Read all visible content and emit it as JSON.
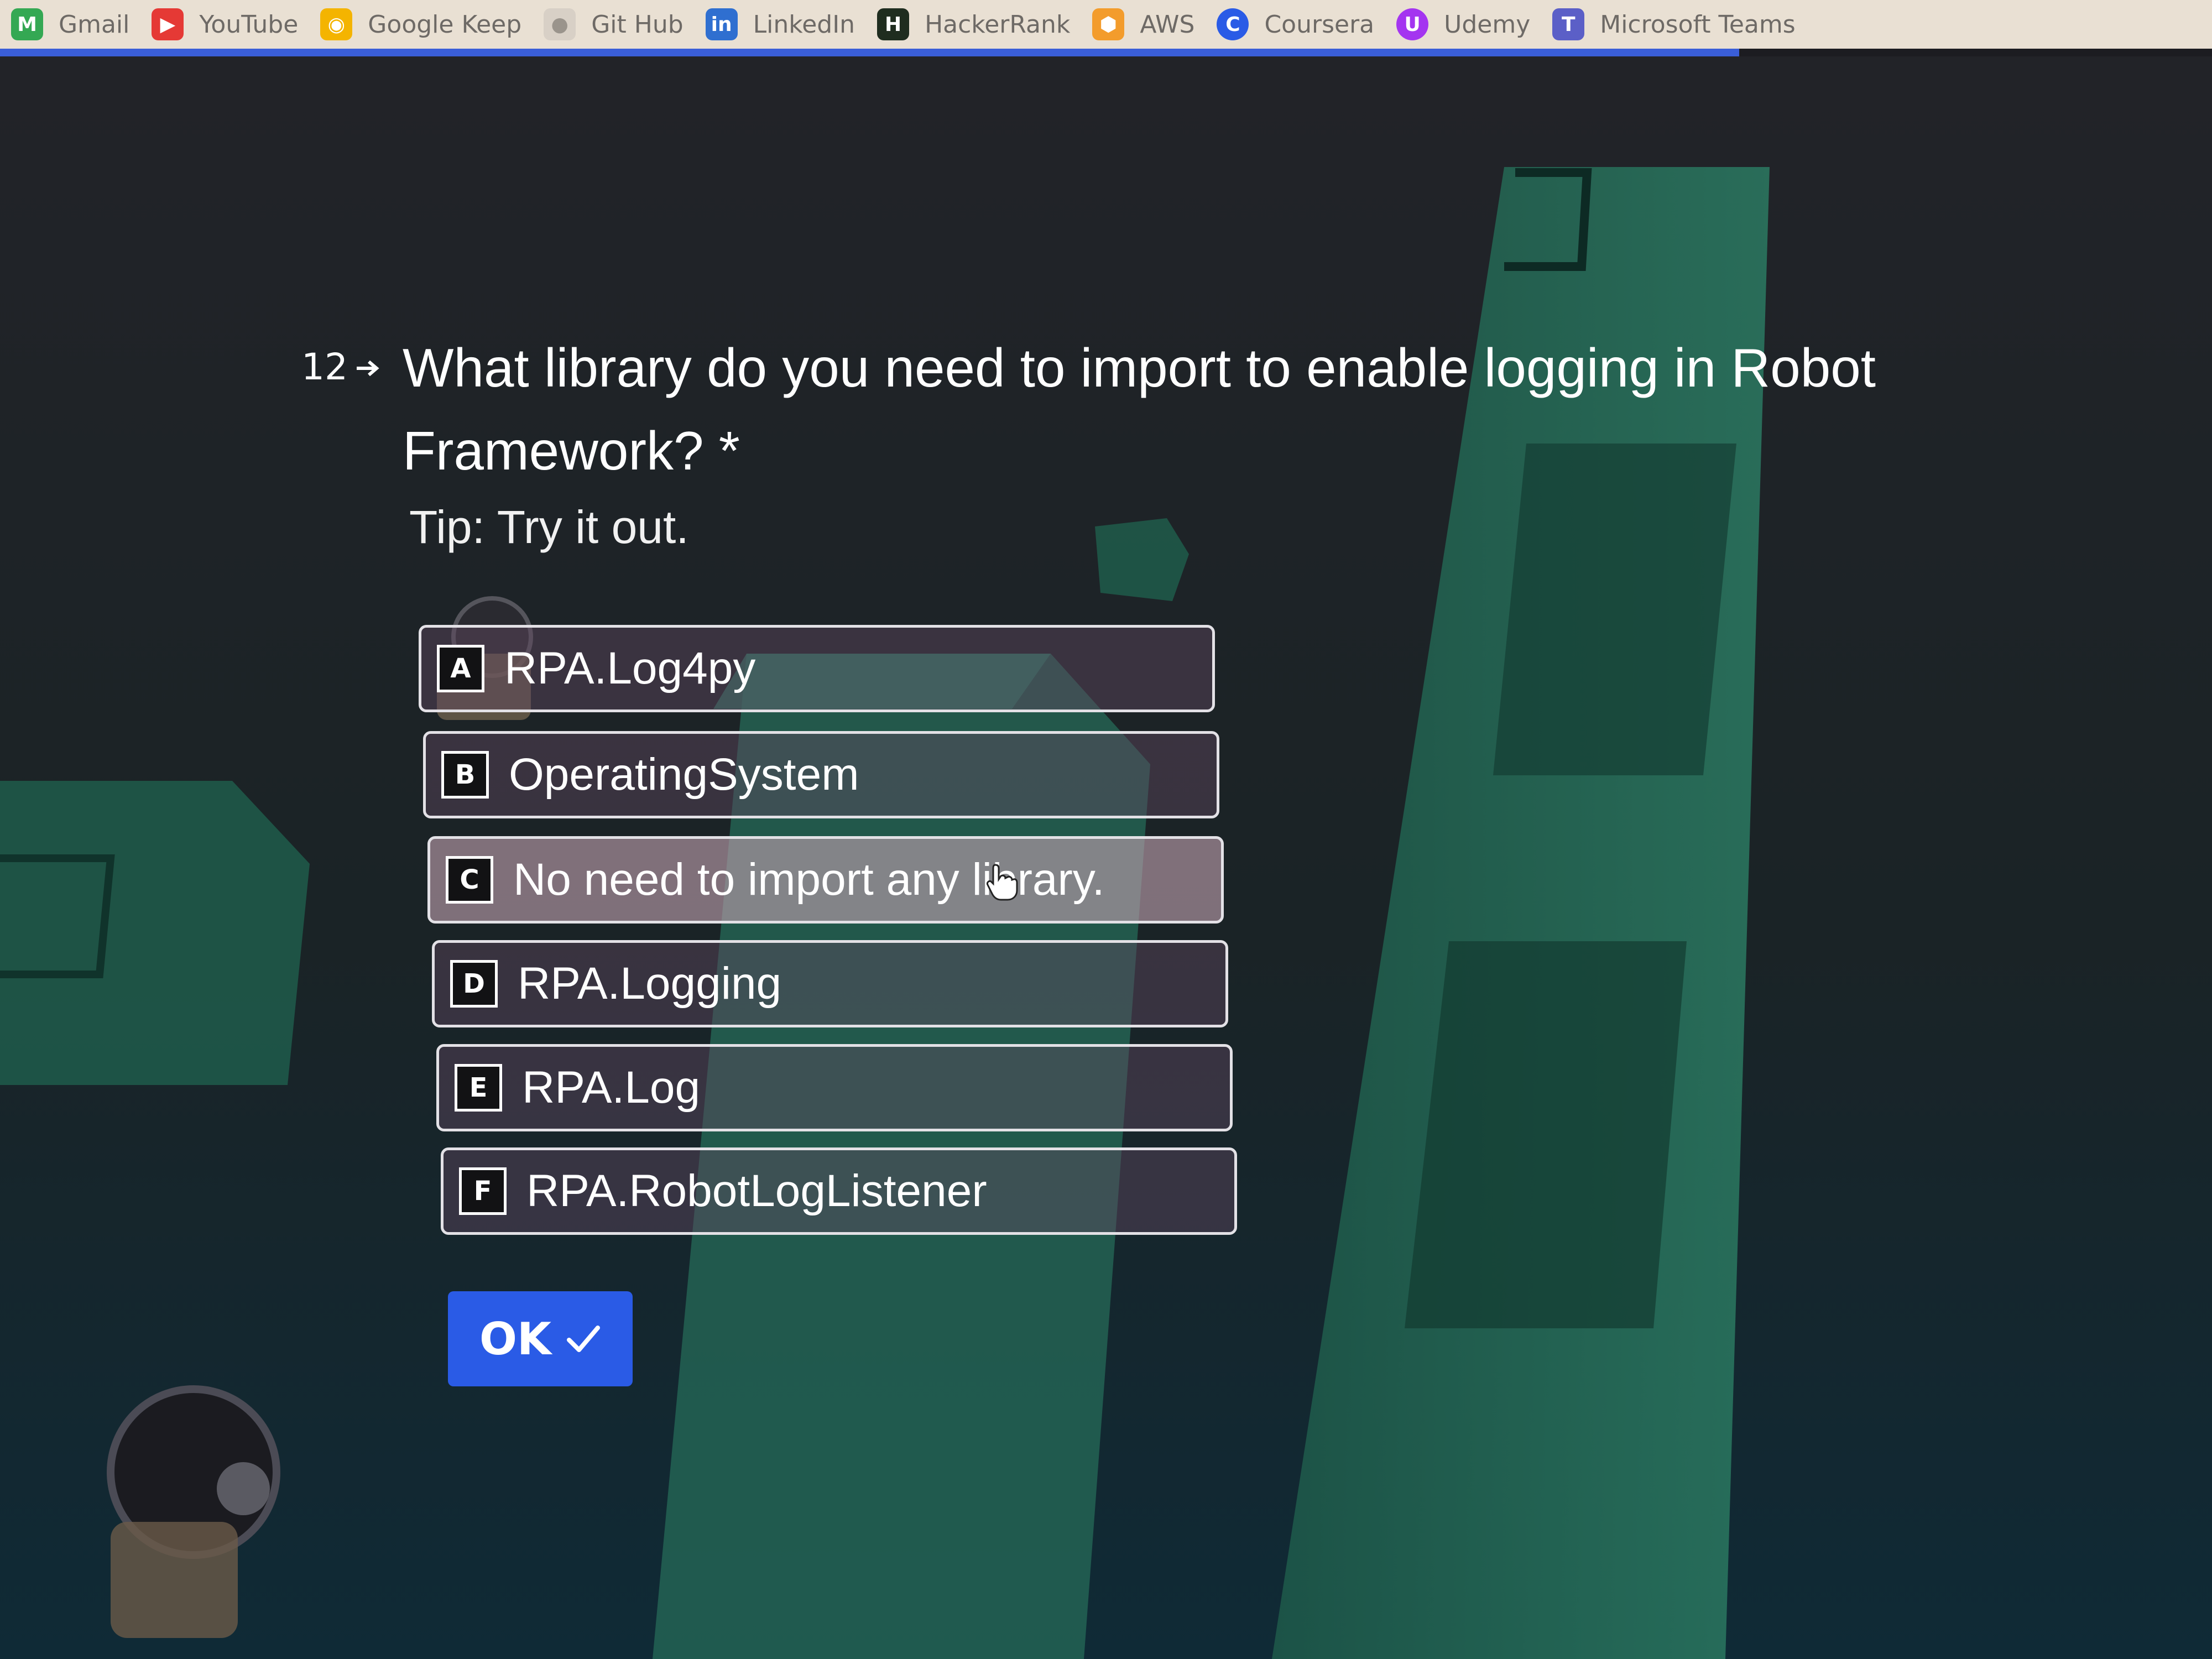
{
  "bookmarks": [
    {
      "label": "Gmail",
      "icon": "gmail-icon",
      "color": "#34a853"
    },
    {
      "label": "YouTube",
      "icon": "youtube-icon",
      "color": "#e53935"
    },
    {
      "label": "Google Keep",
      "icon": "keep-icon",
      "color": "#f4b400"
    },
    {
      "label": "Git Hub",
      "icon": "github-icon",
      "color": "#d8d0c6"
    },
    {
      "label": "LinkedIn",
      "icon": "linkedin-icon",
      "color": "#2f6fd0"
    },
    {
      "label": "HackerRank",
      "icon": "hackerrank-icon",
      "color": "#1f2d1f"
    },
    {
      "label": "AWS",
      "icon": "aws-icon",
      "color": "#f39c2c"
    },
    {
      "label": "Coursera",
      "icon": "coursera-icon",
      "color": "#2a5be6"
    },
    {
      "label": "Udemy",
      "icon": "udemy-icon",
      "color": "#a435f0"
    },
    {
      "label": "Microsoft Teams",
      "icon": "teams-icon",
      "color": "#5b5fc7"
    }
  ],
  "progress": {
    "accent_color": "#3a5ed8"
  },
  "question": {
    "number": "12",
    "text": "What library do you need to import to enable logging in Robot Framework? *",
    "tip": "Tip: Try it out."
  },
  "options": [
    {
      "key": "A",
      "label": "RPA.Log4py"
    },
    {
      "key": "B",
      "label": "OperatingSystem"
    },
    {
      "key": "C",
      "label": "No need to import any library.",
      "selected": true
    },
    {
      "key": "D",
      "label": "RPA.Logging"
    },
    {
      "key": "E",
      "label": "RPA.Log"
    },
    {
      "key": "F",
      "label": "RPA.RobotLogListener"
    }
  ],
  "ok_button": {
    "label": "OK",
    "icon": "check-icon",
    "color": "#2a5be6"
  }
}
